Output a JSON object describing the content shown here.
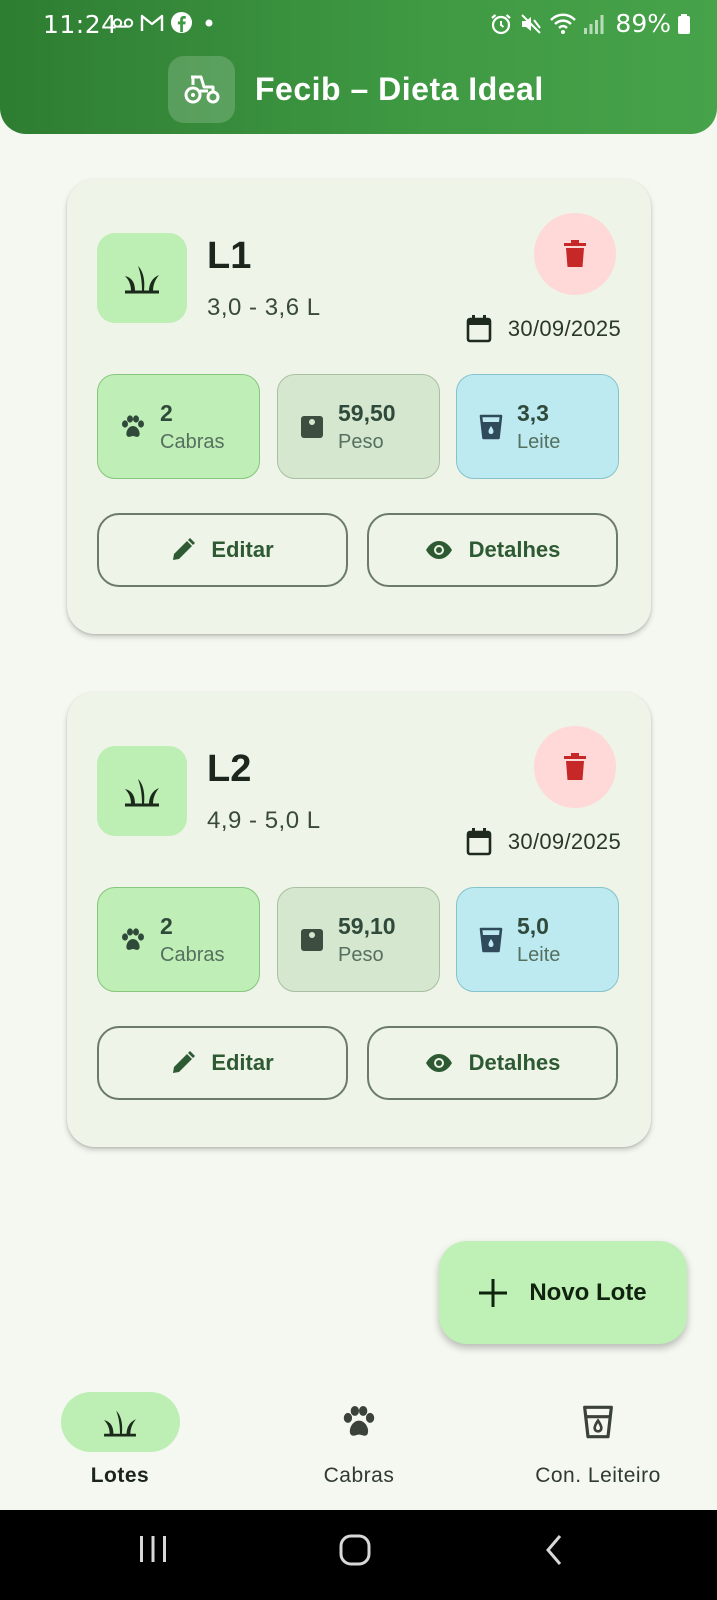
{
  "status_bar": {
    "time": "11:24",
    "battery": "89%",
    "left_icons": [
      "voicemail-icon",
      "gmail-icon",
      "facebook-icon",
      "dot-icon"
    ],
    "right_icons": [
      "alarm-icon",
      "mute-icon",
      "wifi-icon",
      "signal-icon",
      "battery-icon"
    ]
  },
  "header": {
    "title": "Fecib – Dieta Ideal",
    "icon": "tractor-icon"
  },
  "lots": [
    {
      "name": "L1",
      "range": "3,0 - 3,6 L",
      "date": "30/09/2025",
      "stats": {
        "goats_value": "2",
        "goats_label": "Cabras",
        "weight_value": "59,50",
        "weight_label": "Peso",
        "milk_value": "3,3",
        "milk_label": "Leite"
      },
      "edit_label": "Editar",
      "details_label": "Detalhes"
    },
    {
      "name": "L2",
      "range": "4,9 - 5,0 L",
      "date": "30/09/2025",
      "stats": {
        "goats_value": "2",
        "goats_label": "Cabras",
        "weight_value": "59,10",
        "weight_label": "Peso",
        "milk_value": "5,0",
        "milk_label": "Leite"
      },
      "edit_label": "Editar",
      "details_label": "Detalhes"
    }
  ],
  "fab": {
    "label": "Novo Lote",
    "icon": "plus-icon"
  },
  "bottom_nav": {
    "items": [
      {
        "label": "Lotes",
        "icon": "grass-icon",
        "active": true
      },
      {
        "label": "Cabras",
        "icon": "paw-icon",
        "active": false
      },
      {
        "label": "Con. Leiteiro",
        "icon": "milk-cup-icon",
        "active": false
      }
    ]
  },
  "colors": {
    "header_green": "#2e7d32",
    "card_bg": "#eef4e8",
    "accent_light_green": "#bdeeb4",
    "delete_red": "#c62828",
    "delete_bg": "#ffd8d8",
    "milk_blue_bg": "#bdeaf0"
  }
}
